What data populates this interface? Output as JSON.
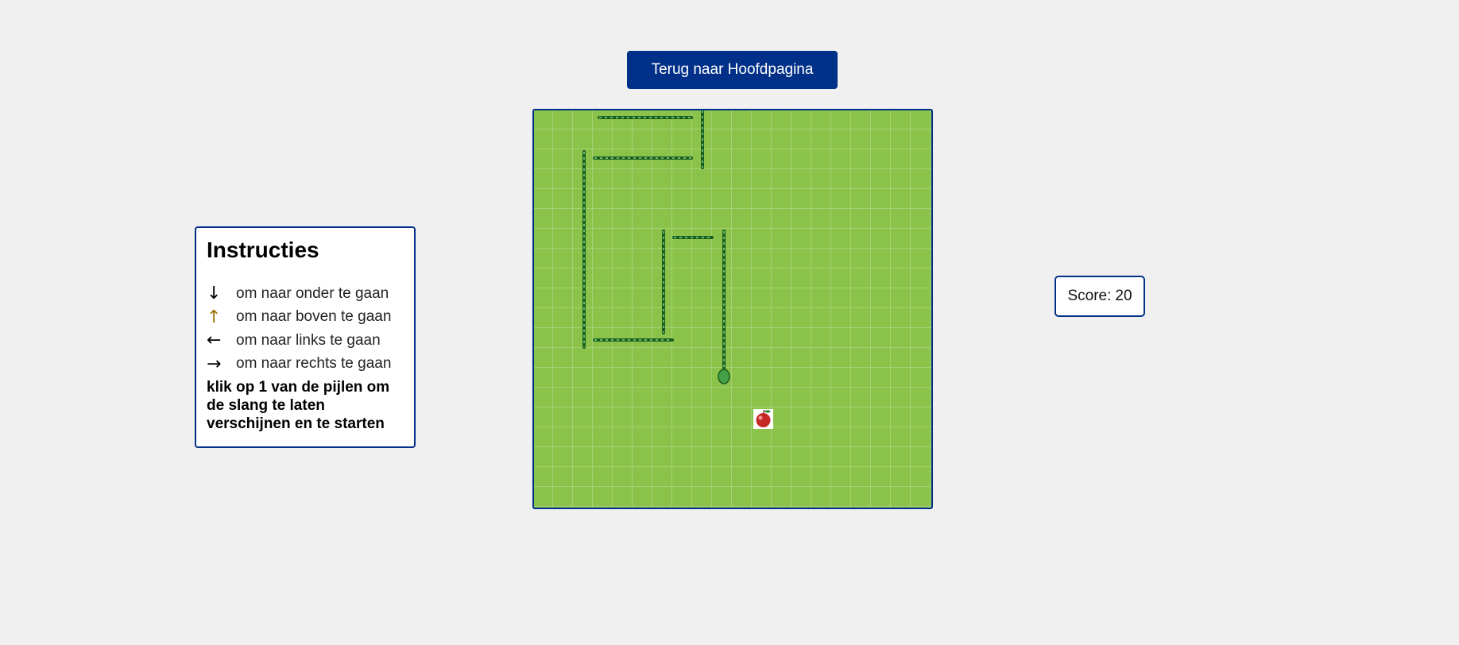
{
  "header": {
    "back_button_label": "Terug naar Hoofdpagina"
  },
  "instructions": {
    "title": "Instructies",
    "items": [
      {
        "icon": "arrow-down-icon",
        "glyph": "↓",
        "label": "om naar onder te gaan"
      },
      {
        "icon": "arrow-up-icon",
        "glyph": "↑",
        "label": "om naar boven te gaan"
      },
      {
        "icon": "arrow-left-icon",
        "glyph": "←",
        "label": "om naar links te gaan"
      },
      {
        "icon": "arrow-right-icon",
        "glyph": "→",
        "label": "om naar rechts te gaan"
      }
    ],
    "note": "klik op 1 van de pijlen om de slang te laten verschijnen en te starten"
  },
  "score": {
    "label": "Score:",
    "value": "20"
  },
  "colors": {
    "accent": "#003087",
    "board": "#8bc34a",
    "snake": "#2e7d32",
    "snake_dark": "#1b5e20"
  },
  "game": {
    "grid_size": 20,
    "food_icon": "apple-icon",
    "snake_head_icon": "snake-head-icon"
  }
}
